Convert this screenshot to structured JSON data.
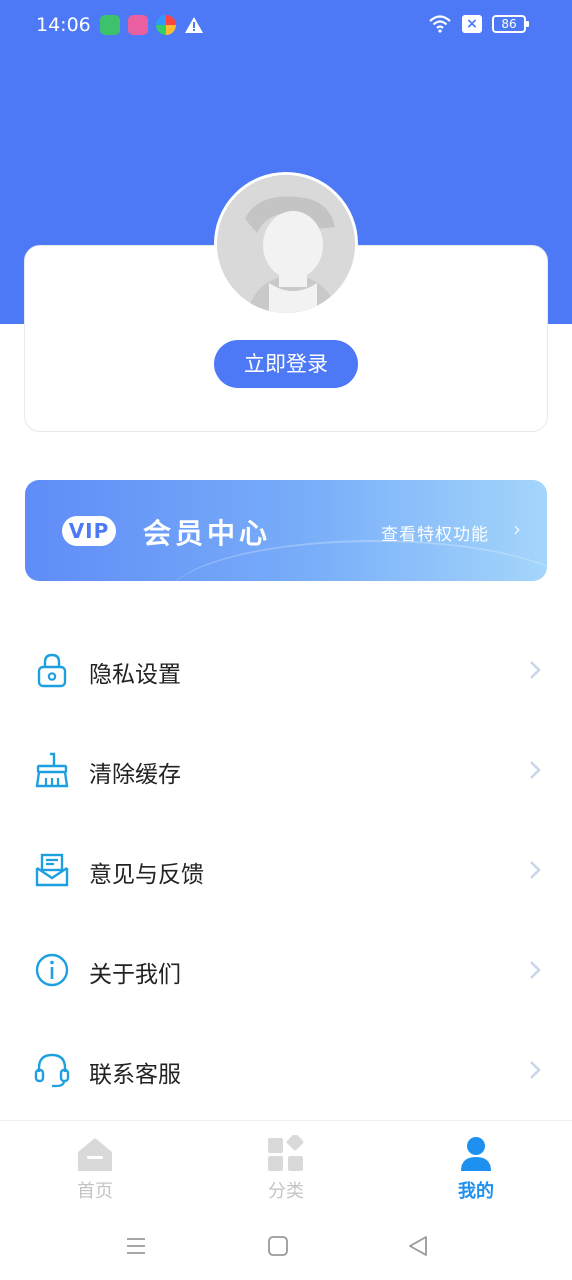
{
  "status_bar": {
    "time": "14:06",
    "battery": "86",
    "icons": [
      "app-icon-green",
      "app-icon-pink",
      "app-icon-multicolor",
      "warning-icon",
      "wifi-icon",
      "no-sim-icon",
      "battery-icon"
    ]
  },
  "profile": {
    "avatar": "default-avatar",
    "login_label": "立即登录"
  },
  "vip": {
    "badge": "VIP",
    "title": "会员中心",
    "privileges": "查看特权功能"
  },
  "menu": {
    "items": [
      {
        "label": "隐私设置",
        "icon": "lock-icon"
      },
      {
        "label": "清除缓存",
        "icon": "broom-icon"
      },
      {
        "label": "意见与反馈",
        "icon": "feedback-mail-icon"
      },
      {
        "label": "关于我们",
        "icon": "info-icon"
      },
      {
        "label": "联系客服",
        "icon": "headset-icon"
      }
    ]
  },
  "tabbar": {
    "tabs": [
      {
        "label": "首页",
        "icon": "home-icon",
        "active": false
      },
      {
        "label": "分类",
        "icon": "category-icon",
        "active": false
      },
      {
        "label": "我的",
        "icon": "user-icon",
        "active": true
      }
    ]
  },
  "colors": {
    "primary": "#4d79f6",
    "accent_icon": "#1ea0e0",
    "tab_active": "#1e90f0",
    "tab_inactive": "#c4c4c4",
    "chevron": "#c6d6ea"
  }
}
